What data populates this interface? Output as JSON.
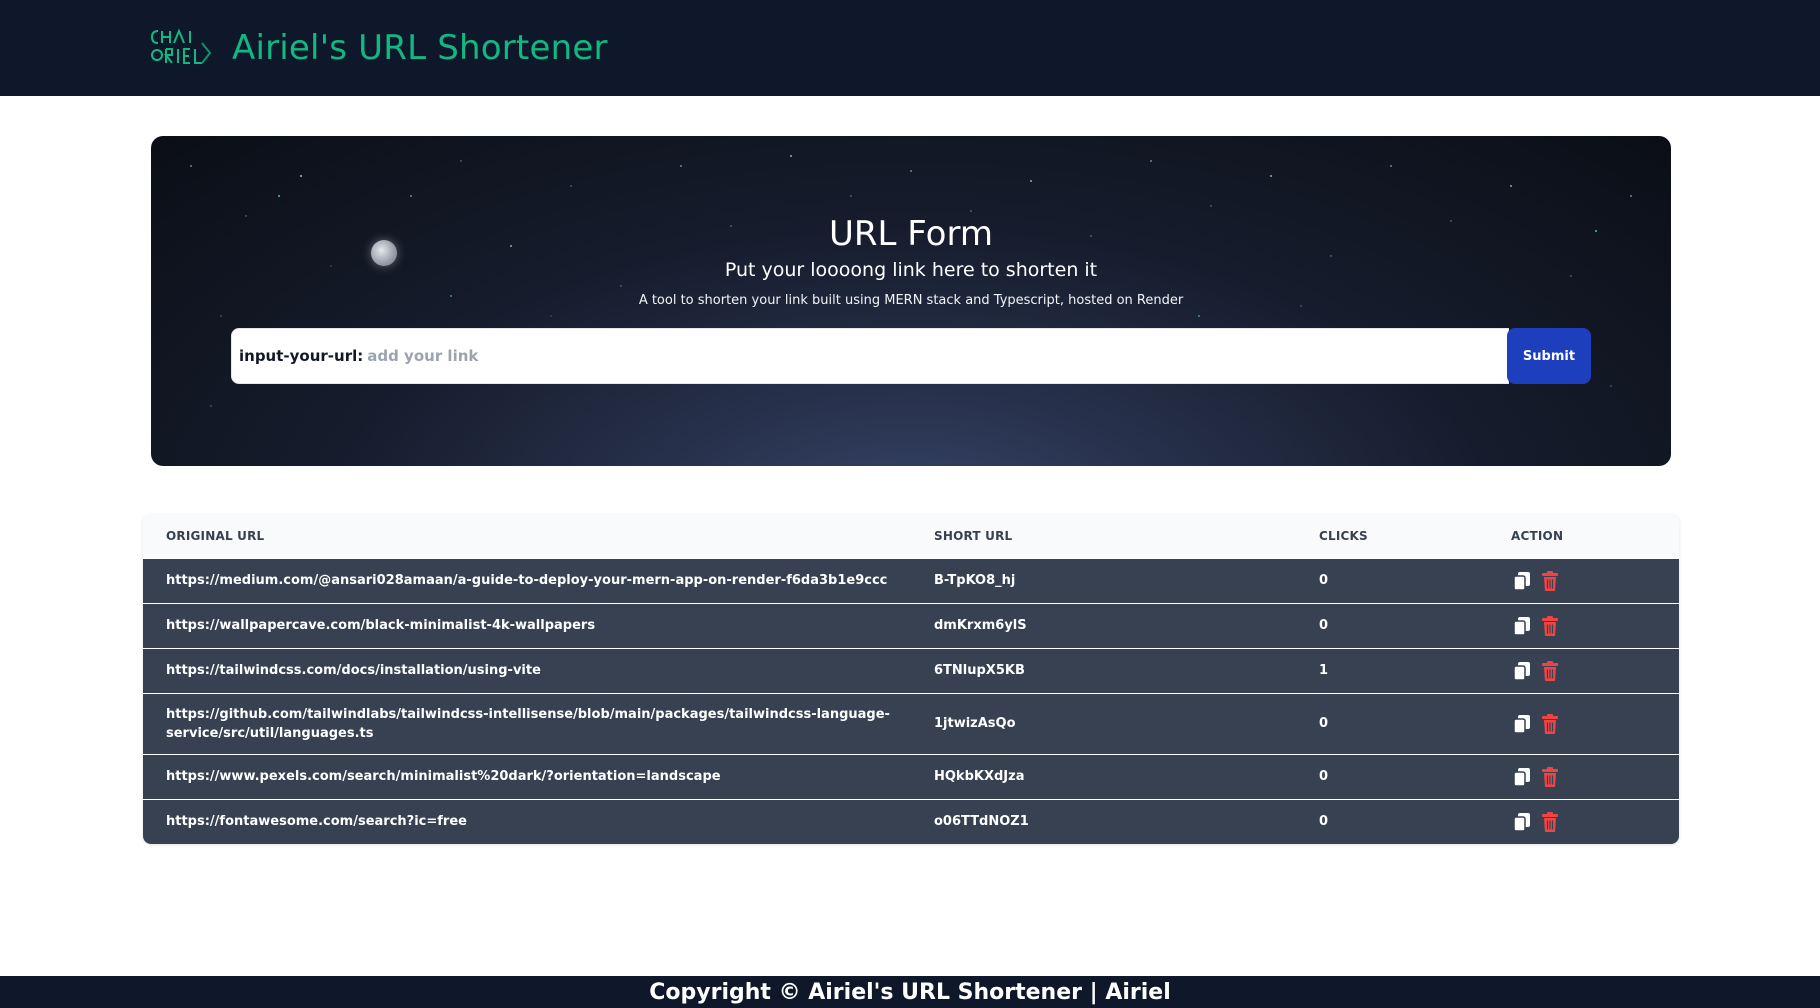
{
  "header": {
    "logo_text": "CHAI RIEL",
    "title": "Airiel's URL Shortener"
  },
  "hero": {
    "title": "URL Form",
    "subtitle": "Put your loooong link here to shorten it",
    "description": "A tool to shorten your link built using MERN stack and Typescript, hosted on Render",
    "input_label": "input-your-url:",
    "input_placeholder": "add your link",
    "input_value": "",
    "submit_label": "Submit"
  },
  "table": {
    "columns": [
      "Original URL",
      "Short URL",
      "Clicks",
      "Action"
    ],
    "rows": [
      {
        "original": "https://medium.com/@ansari028amaan/a-guide-to-deploy-your-mern-app-on-render-f6da3b1e9ccc",
        "short": "B-TpKO8_hj",
        "clicks": "0"
      },
      {
        "original": "https://wallpapercave.com/black-minimalist-4k-wallpapers",
        "short": "dmKrxm6ylS",
        "clicks": "0"
      },
      {
        "original": "https://tailwindcss.com/docs/installation/using-vite",
        "short": "6TNlupX5KB",
        "clicks": "1"
      },
      {
        "original": "https://github.com/tailwindlabs/tailwindcss-intellisense/blob/main/packages/tailwindcss-language-service/src/util/languages.ts",
        "short": "1jtwizAsQo",
        "clicks": "0"
      },
      {
        "original": "https://www.pexels.com/search/minimalist%20dark/?orientation=landscape",
        "short": "HQkbKXdJza",
        "clicks": "0"
      },
      {
        "original": "https://fontawesome.com/search?ic=free",
        "short": "o06TTdNOZ1",
        "clicks": "0"
      }
    ],
    "action_icons": [
      "copy-icon",
      "trash-icon"
    ]
  },
  "footer": {
    "text": "Copyright © Airiel's URL Shortener | Airiel"
  },
  "colors": {
    "header_bg": "#0f172a",
    "brand_green": "#10b981",
    "submit_blue": "#1d3fbd",
    "row_bg": "#374151",
    "trash_red": "#ef4444"
  }
}
